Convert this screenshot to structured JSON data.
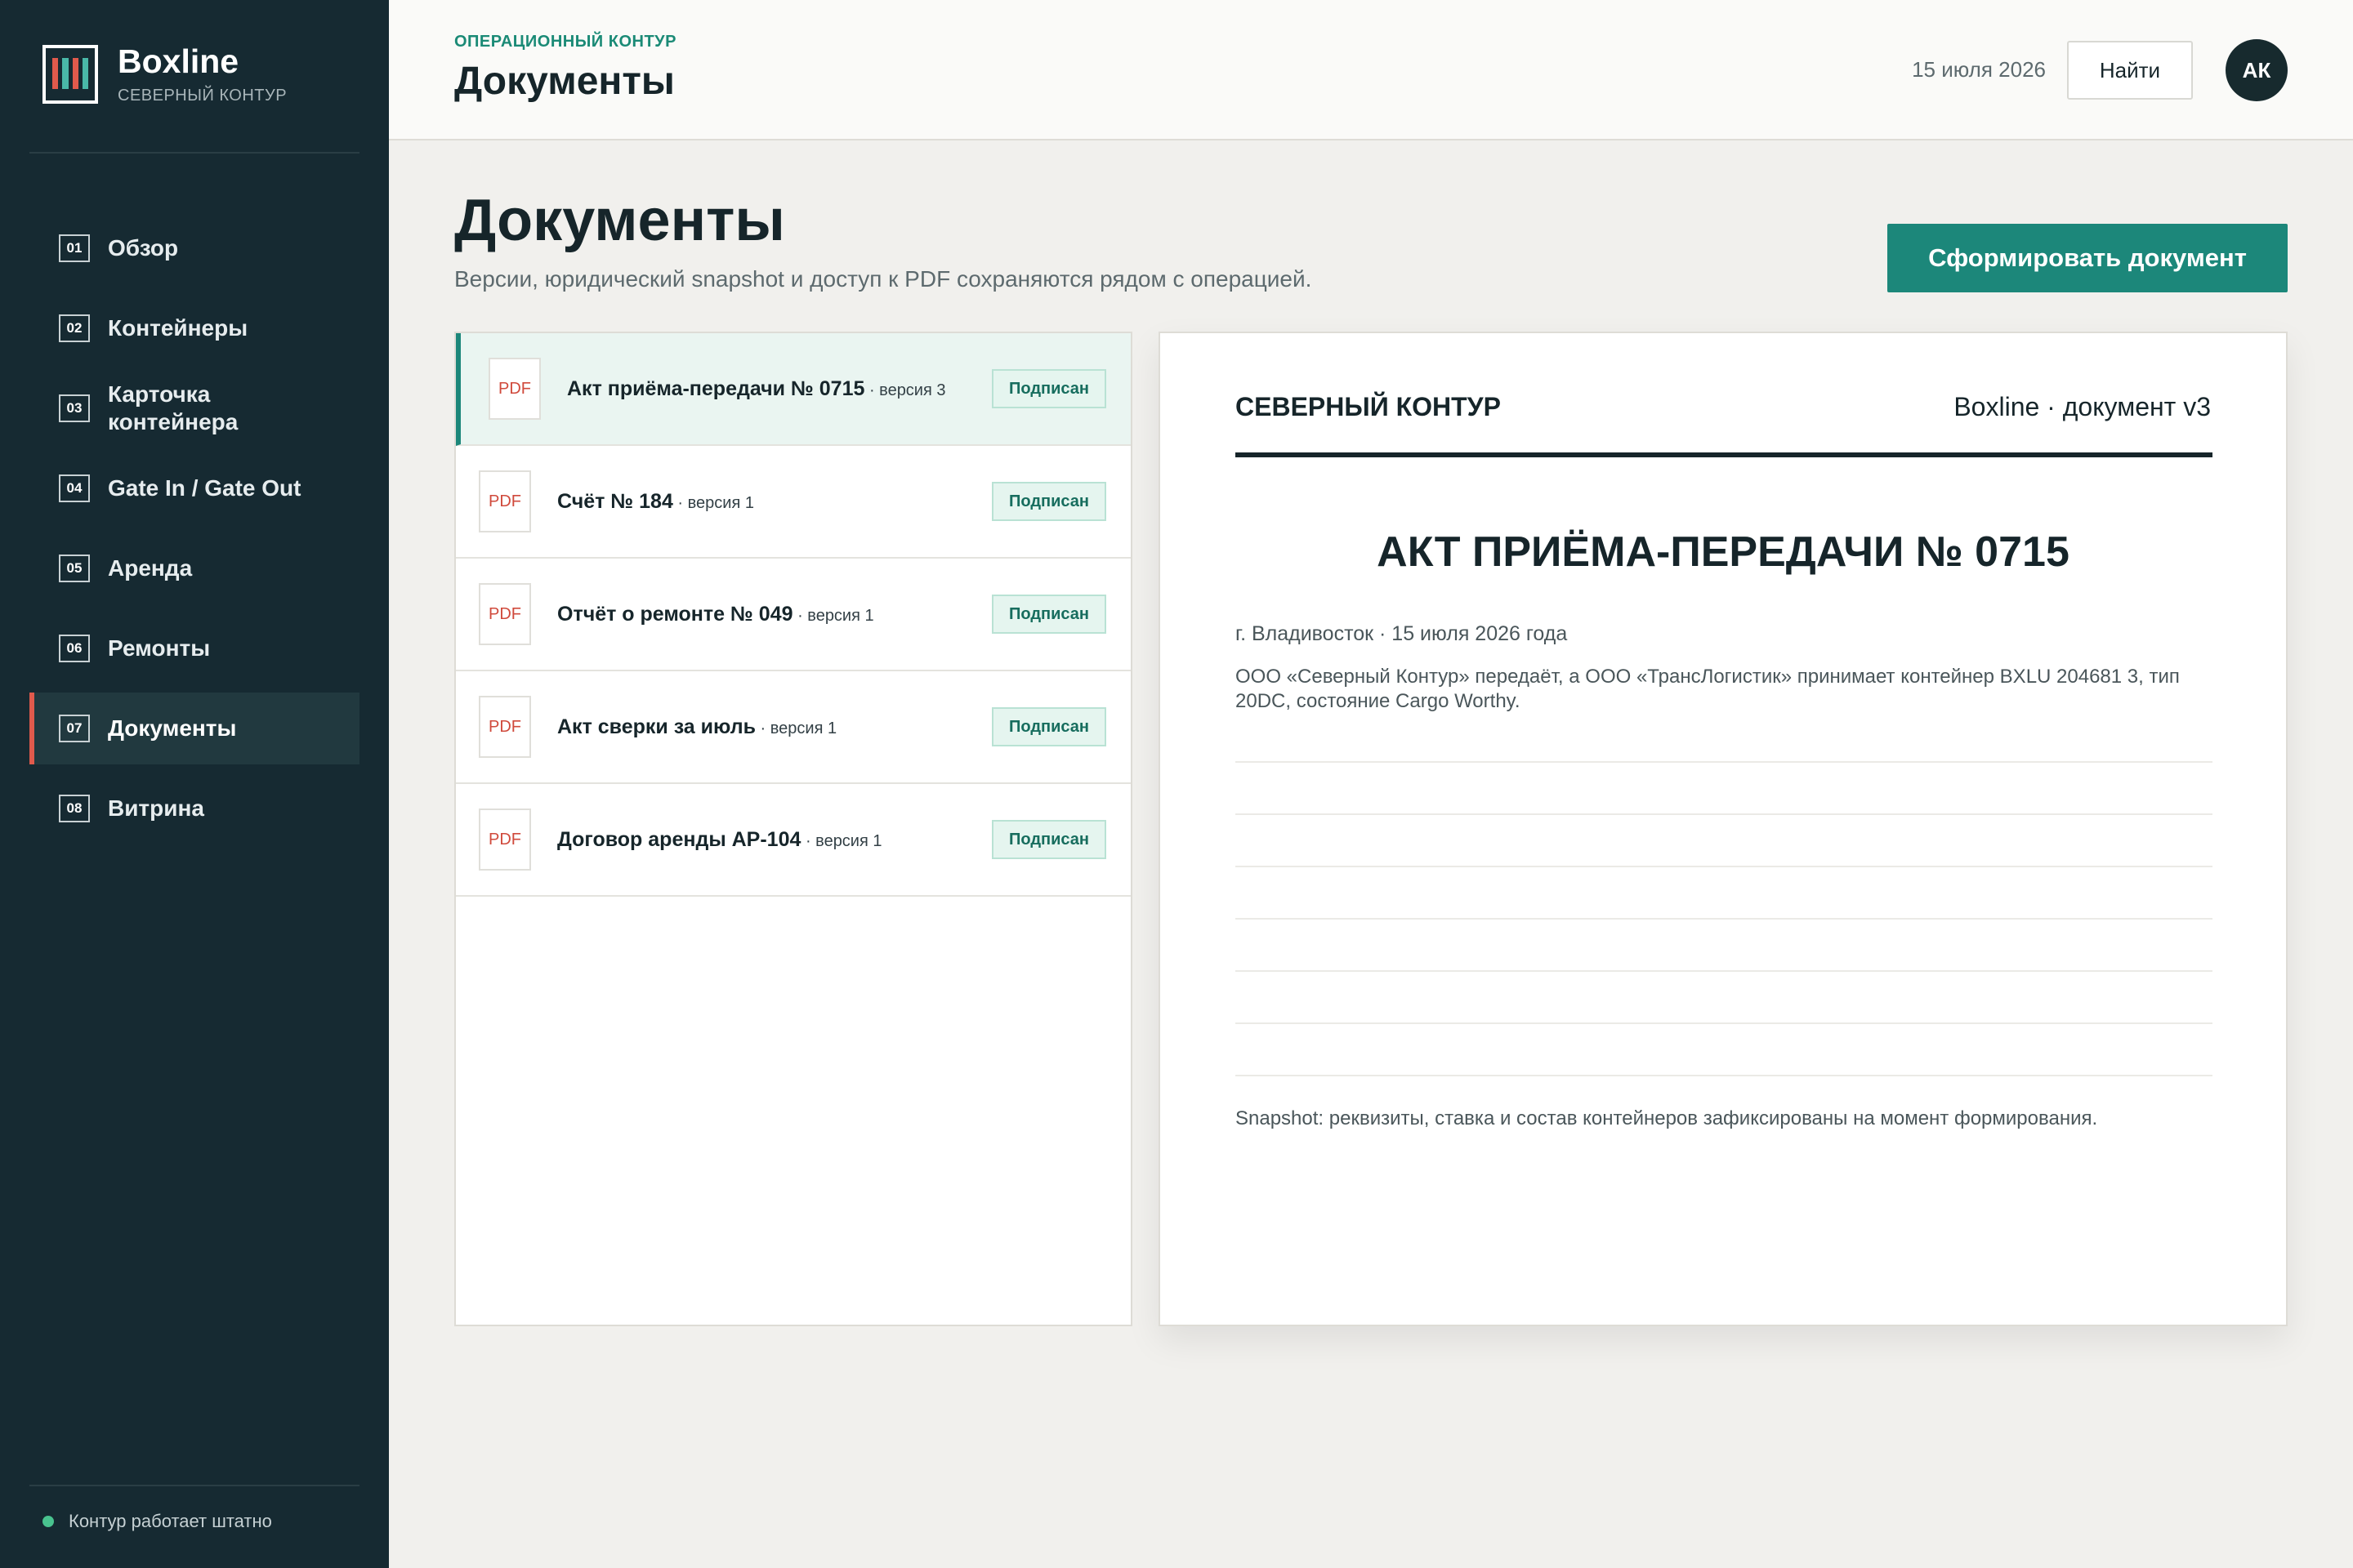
{
  "brand": {
    "name": "Boxline",
    "subtitle": "СЕВЕРНЫЙ КОНТУР",
    "logo_colors": [
      "#e05a4c",
      "#49b8a8",
      "#e05a4c",
      "#49b8a8"
    ]
  },
  "sidebar": {
    "items": [
      {
        "num": "01",
        "label": "Обзор",
        "active": false
      },
      {
        "num": "02",
        "label": "Контейнеры",
        "active": false
      },
      {
        "num": "03",
        "label": "Карточка контейнера",
        "active": false
      },
      {
        "num": "04",
        "label": "Gate In / Gate Out",
        "active": false
      },
      {
        "num": "05",
        "label": "Аренда",
        "active": false
      },
      {
        "num": "06",
        "label": "Ремонты",
        "active": false
      },
      {
        "num": "07",
        "label": "Документы",
        "active": true
      },
      {
        "num": "08",
        "label": "Витрина",
        "active": false
      }
    ],
    "status": "Контур работает штатно"
  },
  "topbar": {
    "eyebrow": "ОПЕРАЦИОННЫЙ КОНТУР",
    "title": "Документы",
    "date": "15 июля 2026",
    "find_label": "Найти",
    "avatar_initials": "АК"
  },
  "page": {
    "title": "Документы",
    "subtitle": "Версии, юридический snapshot и доступ к PDF сохраняются рядом с операцией.",
    "generate_label": "Сформировать документ"
  },
  "documents": [
    {
      "icon_label": "PDF",
      "name": "Акт приёма-передачи № 0715",
      "version": " · версия 3",
      "status": "Подписан",
      "active": true
    },
    {
      "icon_label": "PDF",
      "name": "Счёт № 184",
      "version": " · версия 1",
      "status": "Подписан",
      "active": false
    },
    {
      "icon_label": "PDF",
      "name": "Отчёт о ремонте № 049",
      "version": " · версия 1",
      "status": "Подписан",
      "active": false
    },
    {
      "icon_label": "PDF",
      "name": "Акт сверки за июль",
      "version": " · версия 1",
      "status": "Подписан",
      "active": false
    },
    {
      "icon_label": "PDF",
      "name": "Договор аренды AP-104",
      "version": " · версия 1",
      "status": "Подписан",
      "active": false
    }
  ],
  "preview": {
    "org": "СЕВЕРНЫЙ КОНТУР",
    "meta": "Boxline · документ v3",
    "title": "АКТ ПРИЁМА-ПЕРЕДАЧИ № 0715",
    "place_date": "г. Владивосток · 15 июля 2026 года",
    "body": "ООО «Северный Контур» передаёт, а ООО «ТрансЛогистик» принимает контейнер BXLU 204681 3, тип 20DC, состояние Cargo Worthy.",
    "note": "Snapshot: реквизиты, ставка и состав контейнеров зафиксированы на момент формирования."
  },
  "colors": {
    "accent": "#1c877a",
    "sidebar_bg": "#162a32",
    "active_marker": "#e05a4c",
    "pdf_red": "#d04a3c",
    "status_green": "#49c38f"
  }
}
